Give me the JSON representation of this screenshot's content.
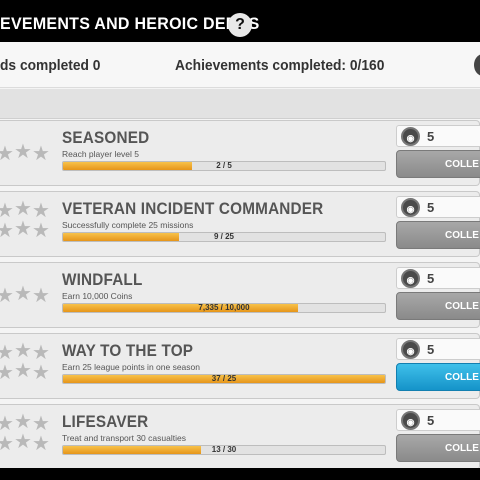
{
  "header": {
    "title": "EVEMENTS AND HEROIC DEEDS",
    "help_label": "?"
  },
  "stats": {
    "left": "ds completed 0",
    "right": "Achievements completed: 0/160"
  },
  "achievements": [
    {
      "name": "SEASONED",
      "desc": "Reach player level 5",
      "progress_text": "2 / 5",
      "progress": 0.4,
      "reward": "5",
      "collect": "COLLE",
      "active": false,
      "stars_rows": 1
    },
    {
      "name": "VETERAN INCIDENT COMMANDER",
      "desc": "Successfully complete 25 missions",
      "progress_text": "9 / 25",
      "progress": 0.36,
      "reward": "5",
      "collect": "COLLE",
      "active": false,
      "stars_rows": 2
    },
    {
      "name": "WINDFALL",
      "desc": "Earn 10,000 Coins",
      "progress_text": "7,335 / 10,000",
      "progress": 0.73,
      "reward": "5",
      "collect": "COLLE",
      "active": false,
      "stars_rows": 1
    },
    {
      "name": "WAY TO THE TOP",
      "desc": "Earn 25 league points in one season",
      "progress_text": "37 / 25",
      "progress": 1.0,
      "reward": "5",
      "collect": "COLLE",
      "active": true,
      "stars_rows": 2
    },
    {
      "name": "LIFESAVER",
      "desc": "Treat and transport 30 casualties",
      "progress_text": "13 / 30",
      "progress": 0.43,
      "reward": "5",
      "collect": "COLLE",
      "active": false,
      "stars_rows": 2
    }
  ],
  "colors": {
    "progress_fill": "#f0ad2c",
    "collect_active": "#2aaadd",
    "collect_inactive": "#9a9a9a"
  },
  "icons": {
    "star": "star-icon",
    "medal": "medal-icon",
    "help": "question-icon"
  }
}
